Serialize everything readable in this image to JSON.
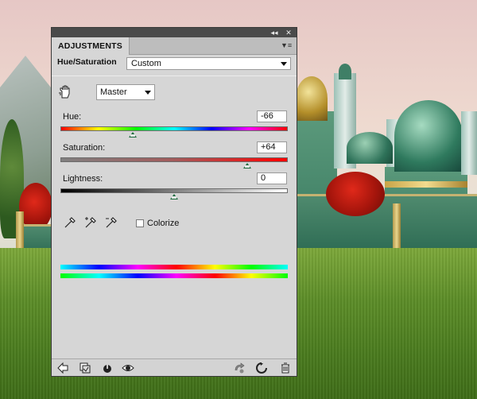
{
  "panel": {
    "tab_label": "ADJUSTMENTS",
    "adjustment_name": "Hue/Saturation",
    "preset": "Custom",
    "channel": "Master",
    "hue": {
      "label": "Hue:",
      "value": "-66",
      "level": 0.317
    },
    "saturation": {
      "label": "Saturation:",
      "value": "+64",
      "level": 0.82
    },
    "lightness": {
      "label": "Lightness:",
      "value": "0",
      "level": 0.5
    },
    "colorize_label": "Colorize",
    "colorize_checked": false
  },
  "icons": {
    "collapse": "double-chevron-icon",
    "close": "close-icon",
    "panel_menu": "panel-menu-icon",
    "targeted_adjust": "hand-icon",
    "eyedropper": "eyedropper-icon",
    "eyedropper_add": "eyedropper-plus-icon",
    "eyedropper_sub": "eyedropper-minus-icon",
    "back": "back-arrow-icon",
    "clip": "clip-to-layer-icon",
    "toggle": "visibility-toggle-icon",
    "eye": "eye-icon",
    "previous_state": "previous-state-icon",
    "reset": "reset-icon",
    "delete": "trash-icon"
  }
}
